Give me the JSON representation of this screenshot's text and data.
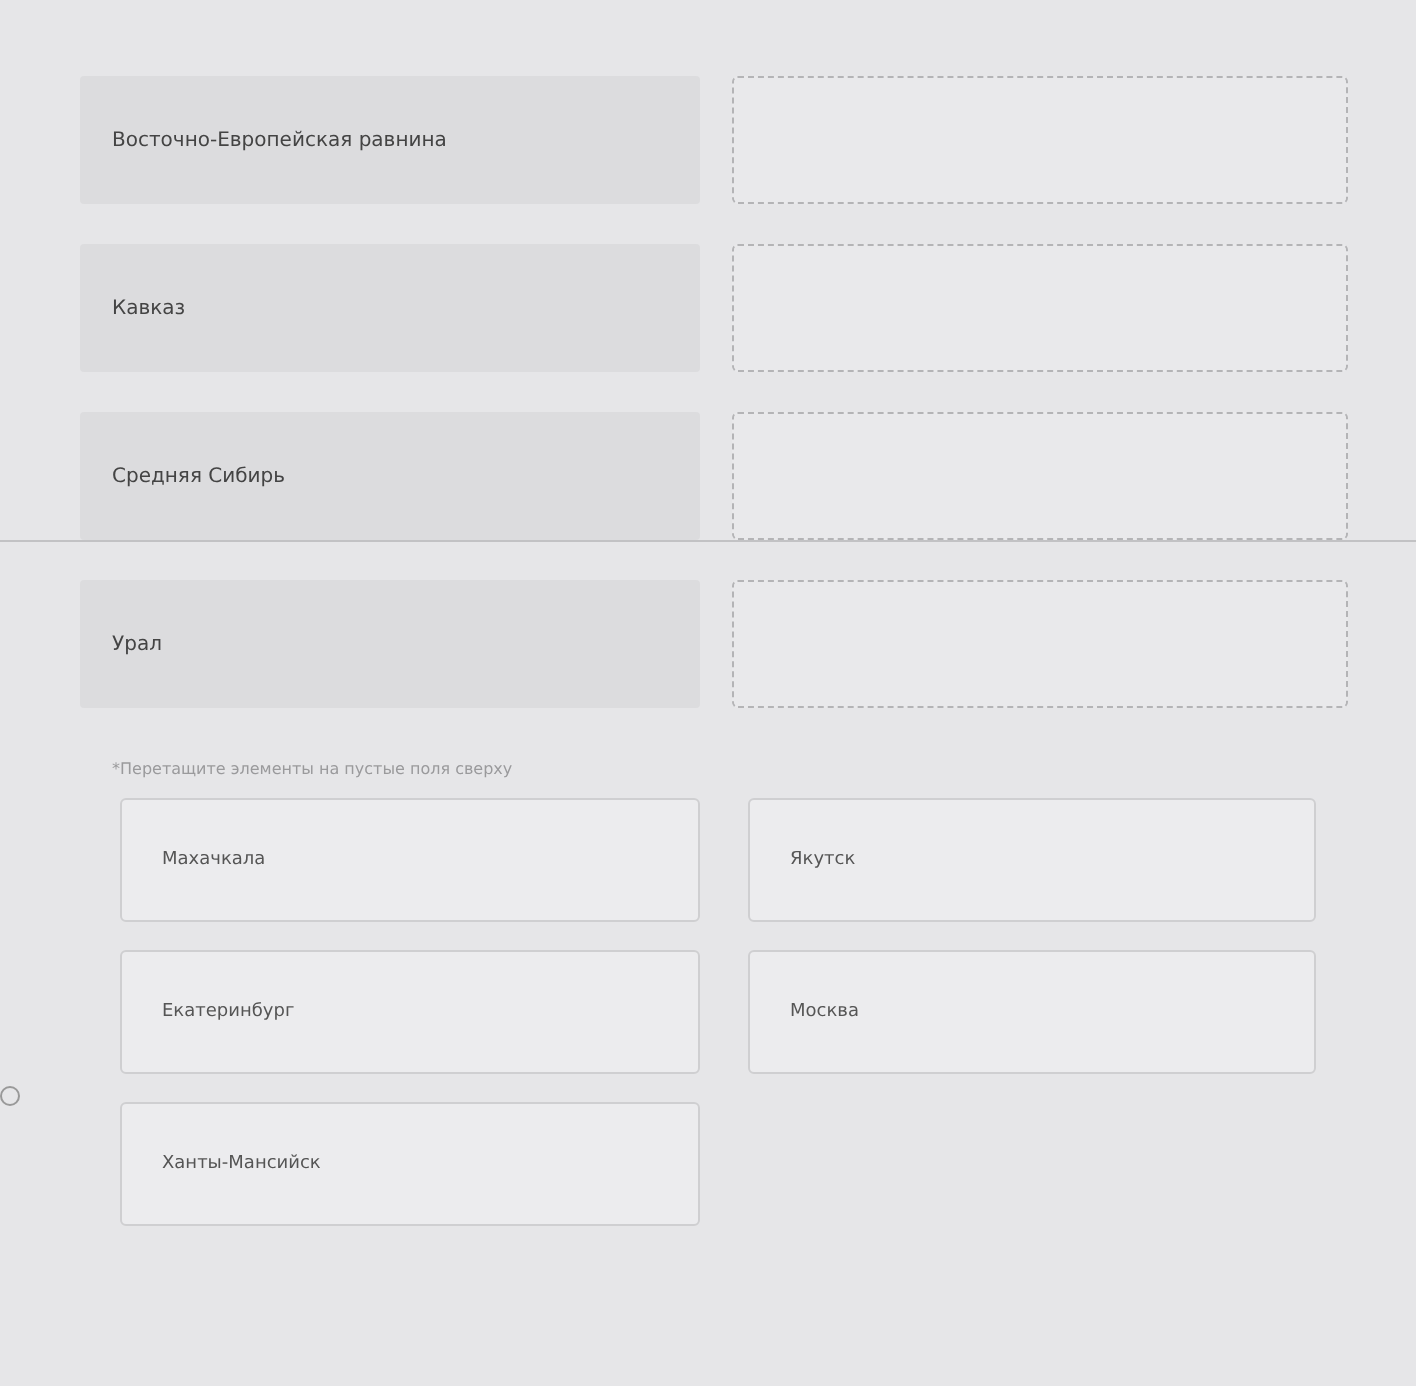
{
  "regions": [
    {
      "label": "Восточно-Европейская равнина"
    },
    {
      "label": "Кавказ"
    },
    {
      "label": "Средняя Сибирь"
    },
    {
      "label": "Урал"
    }
  ],
  "hint": "*Перетащите элементы на пустые поля сверху",
  "options": [
    {
      "label": "Махачкала"
    },
    {
      "label": "Якутск"
    },
    {
      "label": "Екатеринбург"
    },
    {
      "label": "Москва"
    },
    {
      "label": "Ханты-Мансийск"
    }
  ]
}
